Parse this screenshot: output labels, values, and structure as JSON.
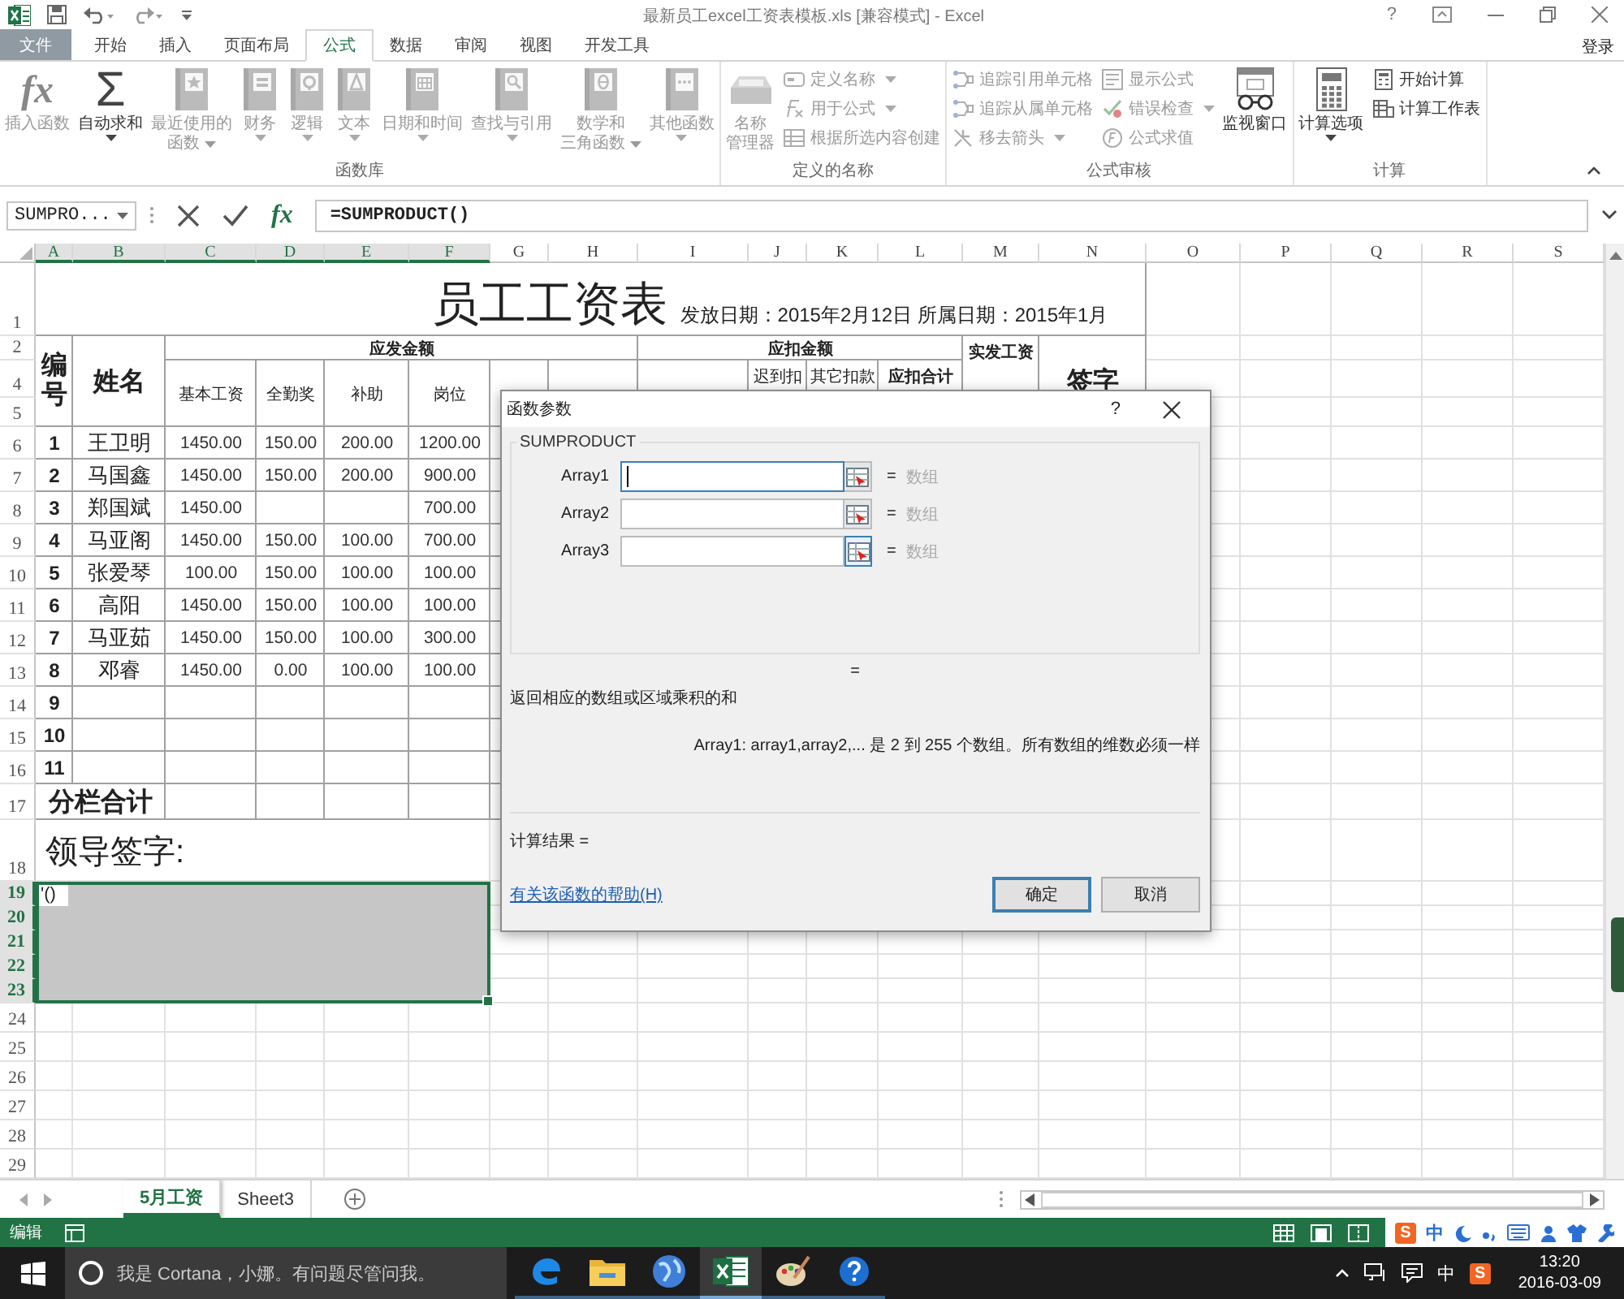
{
  "title_bar": {
    "title": "最新员工excel工资表模板.xls  [兼容模式] - Excel",
    "help": "?"
  },
  "tabs": [
    {
      "label": "文件",
      "kind": "file",
      "selected": false
    },
    {
      "label": "开始",
      "kind": "tab",
      "selected": false
    },
    {
      "label": "插入",
      "kind": "tab",
      "selected": false
    },
    {
      "label": "页面布局",
      "kind": "tab",
      "selected": false
    },
    {
      "label": "公式",
      "kind": "tab",
      "selected": true
    },
    {
      "label": "数据",
      "kind": "tab",
      "selected": false
    },
    {
      "label": "审阅",
      "kind": "tab",
      "selected": false
    },
    {
      "label": "视图",
      "kind": "tab",
      "selected": false
    },
    {
      "label": "开发工具",
      "kind": "tab",
      "selected": false
    }
  ],
  "account": "登录",
  "ribbon": {
    "groups": [
      {
        "label": "函数库",
        "items": [
          {
            "kind": "large",
            "glyph": "fx",
            "lines": [
              "插入函数"
            ],
            "dropdown": false,
            "disabled": true
          },
          {
            "kind": "large",
            "glyph": "Σ",
            "lines": [
              "自动求和"
            ],
            "dropdown": true,
            "disabled": false
          },
          {
            "kind": "large",
            "lines": [
              "最近使用的",
              "函数"
            ],
            "dropdown": true,
            "disabled": true
          },
          {
            "kind": "large",
            "lines": [
              "财务"
            ],
            "dropdown": true,
            "disabled": true
          },
          {
            "kind": "large",
            "lines": [
              "逻辑"
            ],
            "dropdown": true,
            "disabled": true
          },
          {
            "kind": "large",
            "lines": [
              "文本"
            ],
            "dropdown": true,
            "disabled": true
          },
          {
            "kind": "large",
            "lines": [
              "日期和时间"
            ],
            "dropdown": true,
            "disabled": true
          },
          {
            "kind": "large",
            "lines": [
              "查找与引用"
            ],
            "dropdown": true,
            "disabled": true
          },
          {
            "kind": "large",
            "lines": [
              "数学和",
              "三角函数"
            ],
            "dropdown": true,
            "disabled": true
          },
          {
            "kind": "large",
            "lines": [
              "其他函数"
            ],
            "dropdown": true,
            "disabled": true
          }
        ]
      },
      {
        "label": "定义的名称",
        "items": [
          {
            "kind": "large",
            "lines": [
              "名称",
              "管理器"
            ],
            "dropdown": false,
            "disabled": true
          },
          {
            "kind": "stack",
            "items": [
              {
                "label": "定义名称",
                "dropdown": true,
                "disabled": true
              },
              {
                "label": "用于公式",
                "dropdown": true,
                "disabled": true
              },
              {
                "label": "根据所选内容创建",
                "dropdown": false,
                "disabled": true
              }
            ]
          }
        ]
      },
      {
        "label": "公式审核",
        "items": [
          {
            "kind": "stack",
            "items": [
              {
                "label": "追踪引用单元格",
                "dropdown": false,
                "disabled": true
              },
              {
                "label": "追踪从属单元格",
                "dropdown": false,
                "disabled": true
              },
              {
                "label": "移去箭头",
                "dropdown": true,
                "disabled": true
              }
            ]
          },
          {
            "kind": "stack",
            "items": [
              {
                "label": "显示公式",
                "dropdown": false,
                "disabled": true
              },
              {
                "label": "错误检查",
                "dropdown": true,
                "disabled": true
              },
              {
                "label": "公式求值",
                "dropdown": false,
                "disabled": true
              }
            ]
          },
          {
            "kind": "large",
            "lines": [
              "监视窗口"
            ],
            "dropdown": false,
            "disabled": false
          }
        ]
      },
      {
        "label": "计算",
        "items": [
          {
            "kind": "large",
            "lines": [
              "计算选项"
            ],
            "dropdown": true,
            "disabled": false
          },
          {
            "kind": "stack",
            "items": [
              {
                "label": "开始计算",
                "dropdown": false,
                "disabled": false
              },
              {
                "label": "计算工作表",
                "dropdown": false,
                "disabled": false
              }
            ]
          }
        ]
      }
    ]
  },
  "formula_bar": {
    "name_box": "SUMPRO...",
    "function_button": "fx",
    "formula": "=SUMPRODUCT()"
  },
  "sheet": {
    "columns": [
      {
        "label": "A",
        "selected": true
      },
      {
        "label": "B",
        "selected": true
      },
      {
        "label": "C",
        "selected": true
      },
      {
        "label": "D",
        "selected": true
      },
      {
        "label": "E",
        "selected": true
      },
      {
        "label": "F",
        "selected": true
      },
      {
        "label": "G",
        "selected": false
      },
      {
        "label": "H",
        "selected": false
      },
      {
        "label": "I",
        "selected": false
      },
      {
        "label": "J",
        "selected": false
      },
      {
        "label": "K",
        "selected": false
      },
      {
        "label": "L",
        "selected": false
      },
      {
        "label": "M",
        "selected": false
      },
      {
        "label": "N",
        "selected": false
      },
      {
        "label": "O",
        "selected": false
      },
      {
        "label": "P",
        "selected": false
      },
      {
        "label": "Q",
        "selected": false
      },
      {
        "label": "R",
        "selected": false
      },
      {
        "label": "S",
        "selected": false
      }
    ],
    "rows": [
      {
        "label": "1",
        "selected": false
      },
      {
        "label": "2",
        "selected": false
      },
      {
        "label": "4",
        "selected": false
      },
      {
        "label": "5",
        "selected": false
      },
      {
        "label": "6",
        "selected": false
      },
      {
        "label": "7",
        "selected": false
      },
      {
        "label": "8",
        "selected": false
      },
      {
        "label": "9",
        "selected": false
      },
      {
        "label": "10",
        "selected": false
      },
      {
        "label": "11",
        "selected": false
      },
      {
        "label": "12",
        "selected": false
      },
      {
        "label": "13",
        "selected": false
      },
      {
        "label": "14",
        "selected": false
      },
      {
        "label": "15",
        "selected": false
      },
      {
        "label": "16",
        "selected": false
      },
      {
        "label": "17",
        "selected": false
      },
      {
        "label": "18",
        "selected": false
      },
      {
        "label": "19",
        "selected": true
      },
      {
        "label": "20",
        "selected": true
      },
      {
        "label": "21",
        "selected": true
      },
      {
        "label": "22",
        "selected": true
      },
      {
        "label": "23",
        "selected": true
      },
      {
        "label": "24",
        "selected": false
      },
      {
        "label": "25",
        "selected": false
      },
      {
        "label": "26",
        "selected": false
      },
      {
        "label": "27",
        "selected": false
      },
      {
        "label": "28",
        "selected": false
      },
      {
        "label": "29",
        "selected": false
      }
    ],
    "cells": [
      {
        "kind": "title",
        "text": "员工工资表",
        "note": "发放日期：2015年2月12日 所属日期：2015年1月"
      },
      {
        "kind": "vertical",
        "text": "编号"
      },
      {
        "kind": "large",
        "text": "姓名"
      },
      {
        "kind": "head",
        "text": "应发金额"
      },
      {
        "kind": "head",
        "text": "应扣金额"
      },
      {
        "kind": "top-bold",
        "text": "实发工资"
      },
      {
        "kind": "large",
        "text": "签字"
      },
      {
        "kind": "sub",
        "text": "基本工资"
      },
      {
        "kind": "sub",
        "text": "全勤奖"
      },
      {
        "kind": "sub",
        "text": "补助"
      },
      {
        "kind": "sub",
        "text": "岗位"
      },
      {
        "kind": "top",
        "text": "迟到扣"
      },
      {
        "kind": "top",
        "text": "其它扣款"
      },
      {
        "kind": "top-bold",
        "text": "应扣合计"
      },
      {
        "kind": "index",
        "text": "1"
      },
      {
        "kind": "name",
        "text": "王卫明"
      },
      {
        "kind": "num",
        "text": "1450.00"
      },
      {
        "kind": "num",
        "text": "150.00"
      },
      {
        "kind": "num",
        "text": "200.00"
      },
      {
        "kind": "num",
        "text": "1200.00"
      },
      {
        "kind": "index",
        "text": "2"
      },
      {
        "kind": "name",
        "text": "马国鑫"
      },
      {
        "kind": "num",
        "text": "1450.00"
      },
      {
        "kind": "num",
        "text": "150.00"
      },
      {
        "kind": "num",
        "text": "200.00"
      },
      {
        "kind": "num",
        "text": "900.00"
      },
      {
        "kind": "index",
        "text": "3"
      },
      {
        "kind": "name",
        "text": "郑国斌"
      },
      {
        "kind": "num",
        "text": "1450.00"
      },
      {
        "kind": "num",
        "text": "700.00"
      },
      {
        "kind": "index",
        "text": "4"
      },
      {
        "kind": "name",
        "text": "马亚阁"
      },
      {
        "kind": "num",
        "text": "1450.00"
      },
      {
        "kind": "num",
        "text": "150.00"
      },
      {
        "kind": "num",
        "text": "100.00"
      },
      {
        "kind": "num",
        "text": "700.00"
      },
      {
        "kind": "index",
        "text": "5"
      },
      {
        "kind": "name",
        "text": "张爱琴"
      },
      {
        "kind": "num",
        "text": "100.00"
      },
      {
        "kind": "num",
        "text": "150.00"
      },
      {
        "kind": "num",
        "text": "100.00"
      },
      {
        "kind": "num",
        "text": "100.00"
      },
      {
        "kind": "index",
        "text": "6"
      },
      {
        "kind": "name",
        "text": "高阳"
      },
      {
        "kind": "num",
        "text": "1450.00"
      },
      {
        "kind": "num",
        "text": "150.00"
      },
      {
        "kind": "num",
        "text": "100.00"
      },
      {
        "kind": "num",
        "text": "100.00"
      },
      {
        "kind": "index",
        "text": "7"
      },
      {
        "kind": "name",
        "text": "马亚茹"
      },
      {
        "kind": "num",
        "text": "1450.00"
      },
      {
        "kind": "num",
        "text": "150.00"
      },
      {
        "kind": "num",
        "text": "100.00"
      },
      {
        "kind": "num",
        "text": "300.00"
      },
      {
        "kind": "index",
        "text": "8"
      },
      {
        "kind": "name",
        "text": "邓睿"
      },
      {
        "kind": "num",
        "text": "1450.00"
      },
      {
        "kind": "num",
        "text": "0.00"
      },
      {
        "kind": "num",
        "text": "100.00"
      },
      {
        "kind": "num",
        "text": "100.00"
      },
      {
        "kind": "index",
        "text": "9"
      },
      {
        "kind": "index",
        "text": "10"
      },
      {
        "kind": "index",
        "text": "11"
      },
      {
        "kind": "large",
        "text": "分栏合计"
      },
      {
        "kind": "sign",
        "text": "领导签字:"
      }
    ],
    "selection": {
      "text": "'()"
    }
  },
  "dialog": {
    "title": "函数参数",
    "help": "?",
    "function": "SUMPRODUCT",
    "args": [
      {
        "label": "Array1",
        "focused": true,
        "hover": false,
        "equals": "=",
        "hint": "数组"
      },
      {
        "label": "Array2",
        "focused": false,
        "hover": false,
        "equals": "=",
        "hint": "数组"
      },
      {
        "label": "Array3",
        "focused": false,
        "hover": true,
        "equals": "=",
        "hint": "数组"
      }
    ],
    "result_equals": "=",
    "description": "返回相应的数组或区域乘积的和",
    "arg_help": "Array1:  array1,array2,... 是 2 到 255 个数组。所有数组的维数必须一样",
    "calc_result": "计算结果 =",
    "help_link": "有关该函数的帮助(H)",
    "buttons": [
      {
        "label": "确定",
        "default": true
      },
      {
        "label": "取消",
        "default": false
      }
    ]
  },
  "sheet_tabs": [
    {
      "label": "5月工资",
      "selected": true
    },
    {
      "label": "Sheet3",
      "selected": false
    }
  ],
  "status_bar": {
    "mode": "编辑",
    "ime": {
      "logo": "S",
      "language": "中"
    }
  },
  "taskbar": {
    "search": "我是 Cortana，小娜。有问题尽管问我。",
    "apps": [
      {
        "kind": "edge",
        "active": false
      },
      {
        "kind": "folder",
        "active": false
      },
      {
        "kind": "globe",
        "active": false
      },
      {
        "kind": "excel",
        "active": true
      },
      {
        "kind": "paint",
        "active": false
      },
      {
        "kind": "help",
        "active": false
      }
    ],
    "ime_language": "中",
    "ime_logo": "S",
    "time": "13:20",
    "date": "2016-03-09"
  }
}
